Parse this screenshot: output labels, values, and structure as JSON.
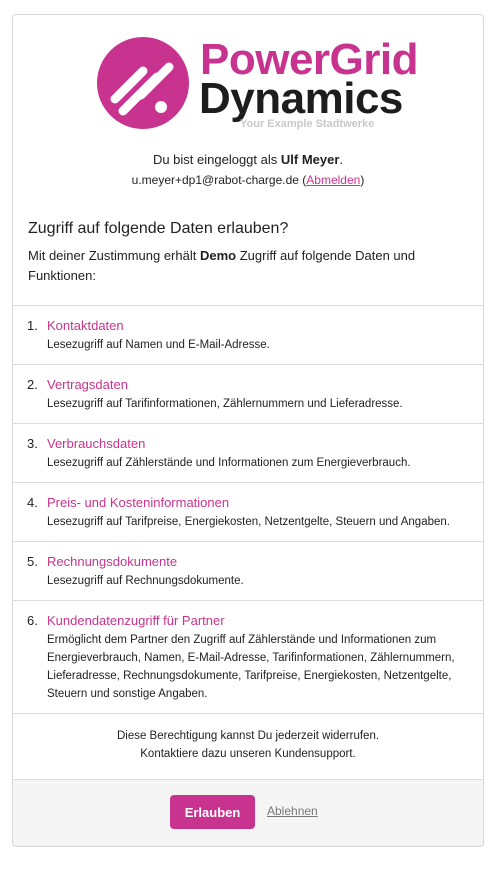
{
  "logo": {
    "line1": "PowerGrid",
    "line2": "Dynamics",
    "tagline": "Your Example Stadtwerke"
  },
  "login": {
    "prefix": "Du bist eingeloggt als",
    "user_name": "Ulf Meyer",
    "suffix": ".",
    "email": "u.meyer+dp1@rabot-charge.de",
    "logout_open": " (",
    "logout_label": "Abmelden",
    "logout_close": ")"
  },
  "consent": {
    "heading": "Zugriff auf folgende Daten erlauben?",
    "intro_prefix": "Mit deiner Zustimmung erhält",
    "client_name": "Demo",
    "intro_suffix": "Zugriff auf folgende Daten und Funktionen:"
  },
  "permissions": [
    {
      "num": "1.",
      "title": "Kontaktdaten",
      "desc": "Lesezugriff auf Namen und E-Mail-Adresse."
    },
    {
      "num": "2.",
      "title": "Vertragsdaten",
      "desc": "Lesezugriff auf Tarifinformationen, Zählernummern und Lieferadresse."
    },
    {
      "num": "3.",
      "title": "Verbrauchsdaten",
      "desc": "Lesezugriff auf Zählerstände und Informationen zum Energieverbrauch."
    },
    {
      "num": "4.",
      "title": "Preis- und Kosteninformationen",
      "desc": "Lesezugriff auf Tarifpreise, Energiekosten, Netzentgelte, Steuern und Angaben."
    },
    {
      "num": "5.",
      "title": "Rechnungsdokumente",
      "desc": "Lesezugriff auf Rechnungsdokumente."
    },
    {
      "num": "6.",
      "title": "Kundendatenzugriff für Partner",
      "desc": "Ermöglicht dem Partner den Zugriff auf Zählerstände und Informationen zum Energieverbrauch, Namen, E-Mail-Adresse, Tarifinformationen, Zählernummern, Lieferadresse, Rechnungsdokumente, Tarifpreise, Energiekosten, Netzentgelte, Steuern und sonstige Angaben."
    }
  ],
  "revoke": {
    "line1": "Diese Berechtigung kannst Du jederzeit widerrufen.",
    "line2": "Kontaktiere dazu unseren Kundensupport."
  },
  "actions": {
    "allow_label": "Erlauben",
    "deny_label": "Ablehnen"
  },
  "colors": {
    "brand": "#c8338f",
    "text": "#222222"
  }
}
